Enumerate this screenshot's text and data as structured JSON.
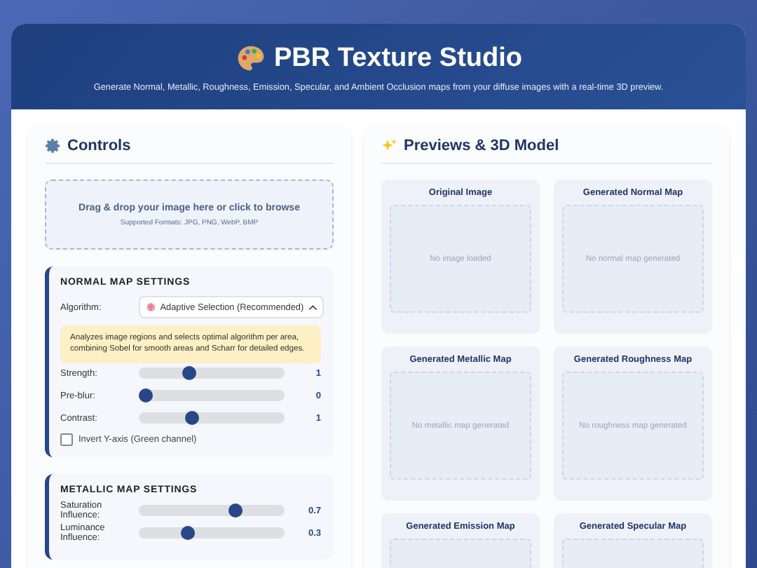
{
  "header": {
    "title": "PBR Texture Studio",
    "subtitle": "Generate Normal, Metallic, Roughness, Emission, Specular, and Ambient Occlusion maps from your diffuse images with a real-time 3D preview."
  },
  "controls": {
    "title": "Controls",
    "dropzone": {
      "title": "Drag & drop your image here or click to browse",
      "formats": "Supported Formats: JPG, PNG, WebP, BMP"
    },
    "sections": [
      {
        "title": "NORMAL MAP SETTINGS",
        "algorithm": {
          "label": "Algorithm:",
          "value": "Adaptive Selection (Recommended)"
        },
        "info": "Analyzes image regions and selects optimal algorithm per area, combining Sobel for smooth areas and Scharr for detailed edges.",
        "sliders": [
          {
            "label": "Strength:",
            "level": 0.33,
            "reading": "1"
          },
          {
            "label": "Pre-blur:",
            "level": 0.0,
            "reading": "0"
          },
          {
            "label": "Contrast:",
            "level": 0.35,
            "reading": "1"
          }
        ],
        "checkbox": {
          "label": "Invert Y-axis (Green channel)",
          "checked": false
        }
      },
      {
        "title": "METALLIC MAP SETTINGS",
        "sliders": [
          {
            "label": "Saturation Influence:",
            "level": 0.68,
            "reading": "0.7"
          },
          {
            "label": "Luminance Influence:",
            "level": 0.32,
            "reading": "0.3"
          }
        ]
      }
    ]
  },
  "previews": {
    "title": "Previews & 3D Model",
    "cards": [
      {
        "title": "Original Image",
        "empty": "No image loaded"
      },
      {
        "title": "Generated Normal Map",
        "empty": "No normal map generated"
      },
      {
        "title": "Generated Metallic Map",
        "empty": "No metallic map generated"
      },
      {
        "title": "Generated Roughness Map",
        "empty": "No roughness map generated"
      },
      {
        "title": "Generated Emission Map"
      },
      {
        "title": "Generated Specular Map"
      }
    ]
  }
}
